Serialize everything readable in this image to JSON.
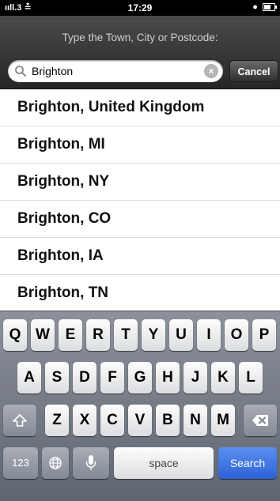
{
  "status_bar": {
    "carrier": "ııll.3 ≛",
    "time": "17:29",
    "right": "●"
  },
  "header": {
    "prompt": "Type the Town, City or Postcode:"
  },
  "search": {
    "value": "Brighton",
    "clear_glyph": "×",
    "cancel_label": "Cancel"
  },
  "results": [
    "Brighton, United Kingdom",
    "Brighton, MI",
    "Brighton, NY",
    "Brighton, CO",
    "Brighton, IA",
    "Brighton, TN"
  ],
  "keyboard": {
    "row1": [
      "Q",
      "W",
      "E",
      "R",
      "T",
      "Y",
      "U",
      "I",
      "O",
      "P"
    ],
    "row2": [
      "A",
      "S",
      "D",
      "F",
      "G",
      "H",
      "J",
      "K",
      "L"
    ],
    "row3": [
      "Z",
      "X",
      "C",
      "V",
      "B",
      "N",
      "M"
    ],
    "numbers_label": "123",
    "space_label": "space",
    "search_label": "Search",
    "icons": [
      "shift-icon",
      "backspace-icon",
      "globe-icon",
      "microphone-icon"
    ]
  }
}
